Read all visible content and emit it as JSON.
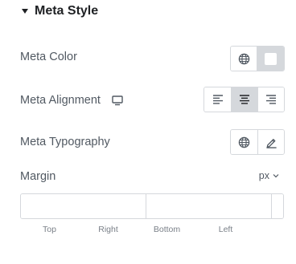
{
  "section": {
    "title": "Meta Style"
  },
  "meta_color": {
    "label": "Meta Color",
    "swatch_color": "#ffffff"
  },
  "meta_alignment": {
    "label": "Meta Alignment",
    "options": [
      "left",
      "center",
      "right"
    ],
    "selected": "center"
  },
  "meta_typography": {
    "label": "Meta Typography"
  },
  "margin": {
    "label": "Margin",
    "unit": "px",
    "inputs": [
      {
        "label": "Top",
        "value": ""
      },
      {
        "label": "Right",
        "value": ""
      },
      {
        "label": "Bottom",
        "value": ""
      },
      {
        "label": "Left",
        "value": ""
      }
    ]
  },
  "colors": {
    "accent_gray": "#d5d8dc",
    "text": "#515962",
    "heading": "#1f2124"
  }
}
